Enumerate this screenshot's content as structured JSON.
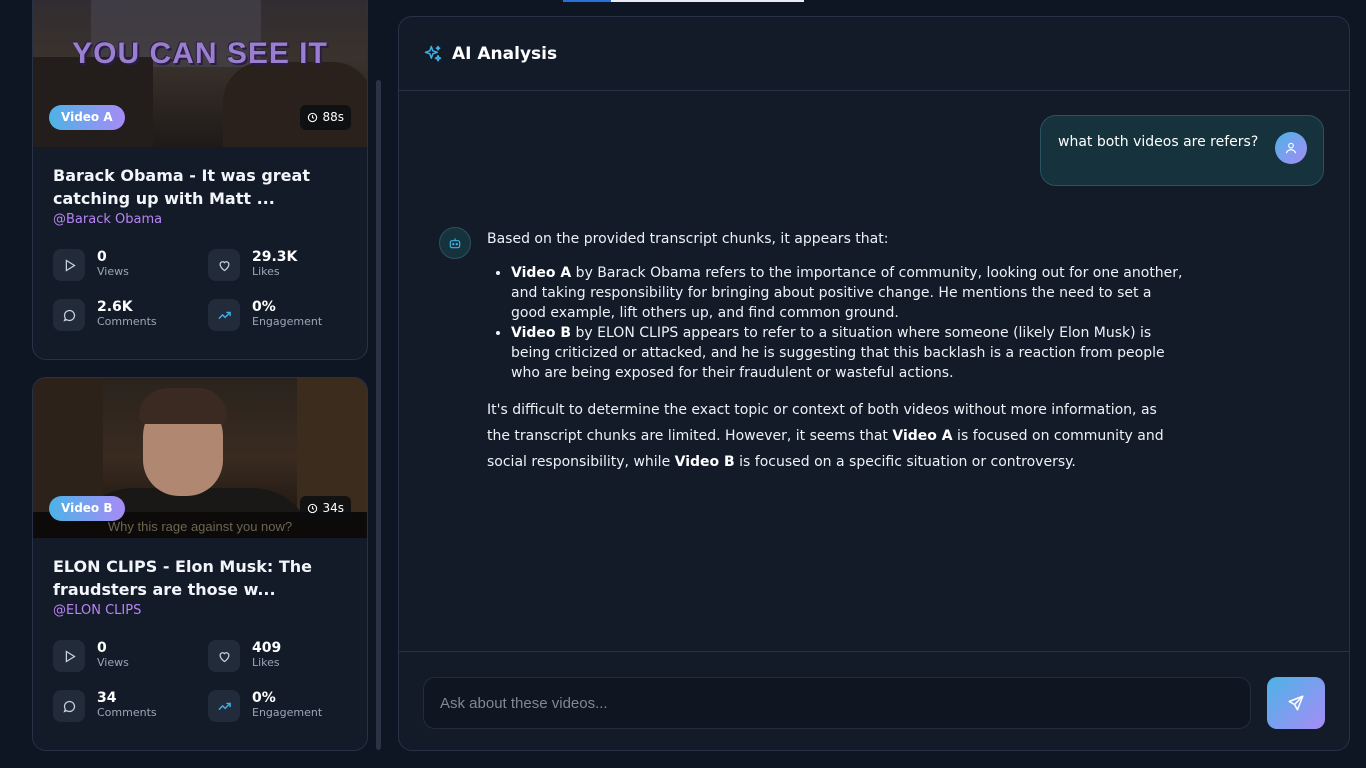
{
  "progress": 0.2,
  "videos": [
    {
      "badge": "Video A",
      "duration": "88s",
      "thumb_caption": "YOU CAN SEE IT",
      "title_line1": "Barack Obama - It was great",
      "title_line2": "catching up with Matt ...",
      "channel": "@Barack Obama",
      "stats": {
        "views": {
          "value": "0",
          "label": "Views"
        },
        "likes": {
          "value": "29.3K",
          "label": "Likes"
        },
        "comments": {
          "value": "2.6K",
          "label": "Comments"
        },
        "engagement": {
          "value": "0%",
          "label": "Engagement"
        }
      }
    },
    {
      "badge": "Video B",
      "duration": "34s",
      "thumb_caption": "Why this rage against you now?",
      "title_line1": "ELON CLIPS - Elon Musk: The",
      "title_line2": "fraudsters are those w...",
      "channel": "@ELON CLIPS",
      "stats": {
        "views": {
          "value": "0",
          "label": "Views"
        },
        "likes": {
          "value": "409",
          "label": "Likes"
        },
        "comments": {
          "value": "34",
          "label": "Comments"
        },
        "engagement": {
          "value": "0%",
          "label": "Engagement"
        }
      }
    }
  ],
  "panel": {
    "title": "AI Analysis",
    "user_message": "what both videos are refers?",
    "bot": {
      "intro": "Based on the provided transcript chunks, it appears that:",
      "items": [
        {
          "bold": "Video A",
          "text": " by Barack Obama refers to the importance of community, looking out for one another, and taking responsibility for bringing about positive change. He mentions the need to set a good example, lift others up, and find common ground."
        },
        {
          "bold": "Video B",
          "text": " by ELON CLIPS appears to refer to a situation where someone (likely Elon Musk) is being criticized or attacked, and he is suggesting that this backlash is a reaction from people who are being exposed for their fraudulent or wasteful actions."
        }
      ],
      "outro": {
        "part1": "It's difficult to determine the exact topic or context of both videos without more information, as the transcript chunks are limited. However, it seems that ",
        "bold1": "Video A",
        "part2": " is focused on community and social responsibility, while ",
        "bold2": "Video B",
        "part3": " is focused on a specific situation or controversy."
      }
    },
    "input_placeholder": "Ask about these videos..."
  },
  "colors": {
    "background": "#0e1624",
    "card": "#131b29",
    "accent_start": "#4cb3e6",
    "accent_end": "#a78bf6",
    "channel": "#b784f4"
  },
  "icons": [
    "clock-icon",
    "play-icon",
    "heart-icon",
    "comment-icon",
    "trending-up-icon",
    "sparkles-icon",
    "user-icon",
    "bot-icon",
    "send-icon"
  ]
}
